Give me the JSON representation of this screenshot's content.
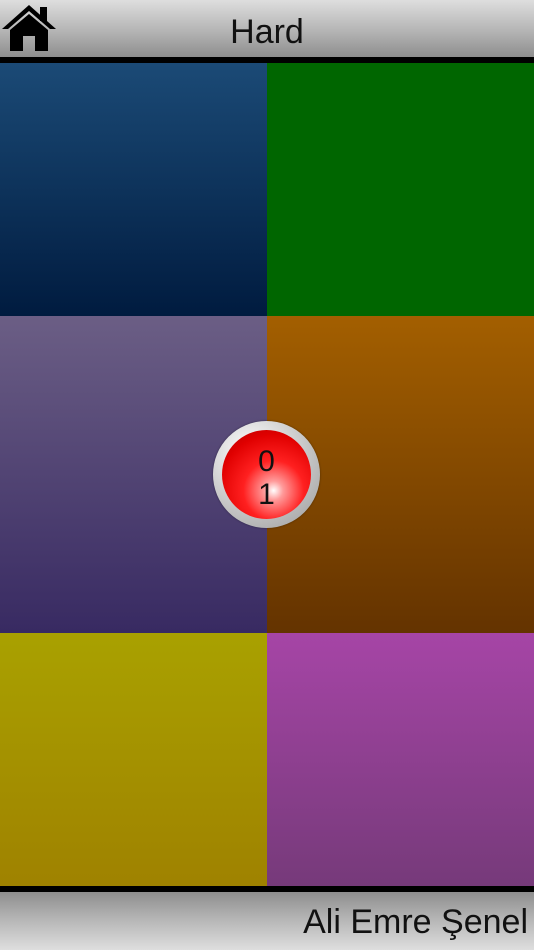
{
  "header": {
    "title": "Hard",
    "home_icon": "home-icon"
  },
  "tiles": [
    {
      "name": "blue",
      "top": "#1b4a76",
      "bottom": "#001b3f"
    },
    {
      "name": "green",
      "top": "#006600",
      "bottom": "#006600"
    },
    {
      "name": "purple",
      "top": "#6b5e85",
      "bottom": "#382a62"
    },
    {
      "name": "orange",
      "top": "#a35f00",
      "bottom": "#643300"
    },
    {
      "name": "yellow",
      "top": "#a9a100",
      "bottom": "#9f8200"
    },
    {
      "name": "magenta",
      "top": "#a645a6",
      "bottom": "#763a7a"
    }
  ],
  "counter": {
    "top_value": "0",
    "bottom_value": "1"
  },
  "footer": {
    "credit": "Ali Emre Şenel"
  }
}
